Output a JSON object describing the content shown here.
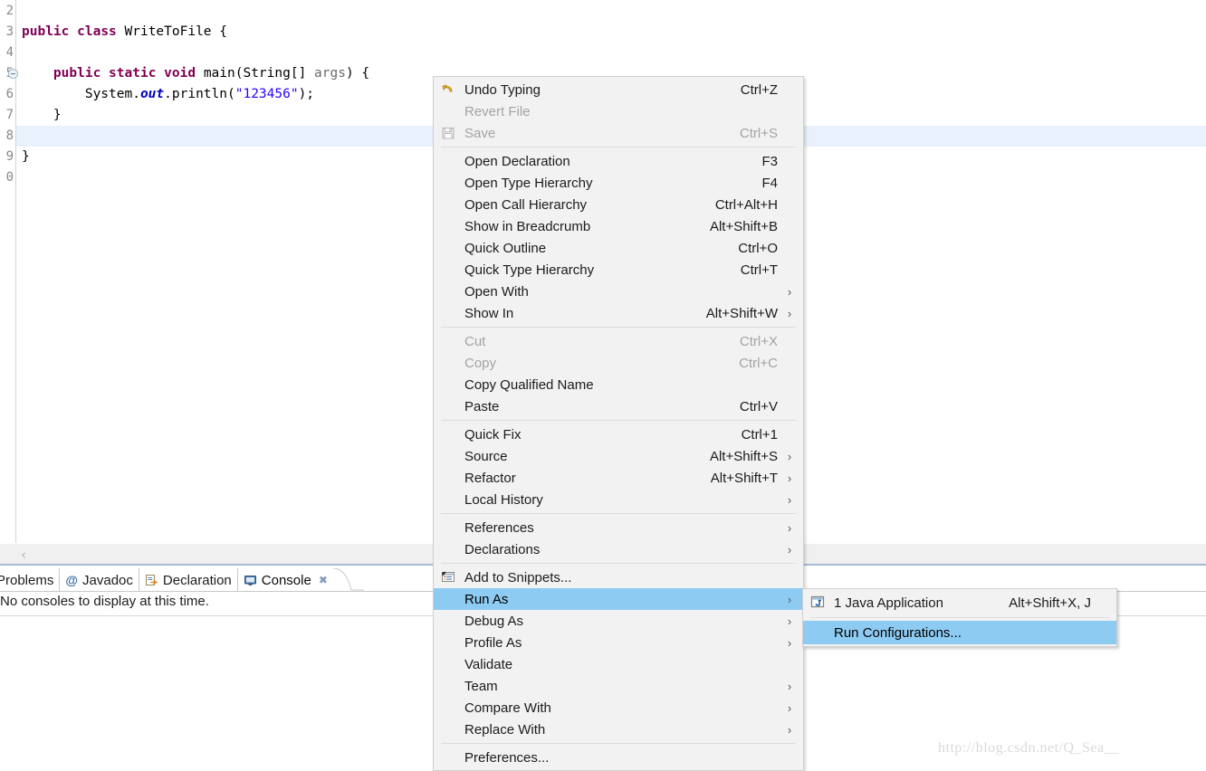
{
  "editor": {
    "gutter_numbers": [
      "2",
      "3",
      "4",
      "5",
      "6",
      "7",
      "8",
      "9",
      "0"
    ],
    "fold_marker_line": "5",
    "current_line": "8",
    "code_lines": [
      {
        "n": "2",
        "tokens": []
      },
      {
        "n": "3",
        "tokens": [
          {
            "t": "public",
            "c": "kw"
          },
          {
            "t": " ",
            "c": "pln"
          },
          {
            "t": "class",
            "c": "kw"
          },
          {
            "t": " WriteToFile {",
            "c": "pln"
          }
        ]
      },
      {
        "n": "4",
        "tokens": []
      },
      {
        "n": "5",
        "tokens": [
          {
            "t": "    ",
            "c": "pln"
          },
          {
            "t": "public",
            "c": "kw"
          },
          {
            "t": " ",
            "c": "pln"
          },
          {
            "t": "static",
            "c": "kw"
          },
          {
            "t": " ",
            "c": "pln"
          },
          {
            "t": "void",
            "c": "kw"
          },
          {
            "t": " main(String[] ",
            "c": "pln"
          },
          {
            "t": "args",
            "c": "gry"
          },
          {
            "t": ") {",
            "c": "pln"
          }
        ]
      },
      {
        "n": "6",
        "tokens": [
          {
            "t": "        System.",
            "c": "pln"
          },
          {
            "t": "out",
            "c": "fld"
          },
          {
            "t": ".println(",
            "c": "pln"
          },
          {
            "t": "\"123456\"",
            "c": "str"
          },
          {
            "t": ");",
            "c": "pln"
          }
        ]
      },
      {
        "n": "7",
        "tokens": [
          {
            "t": "    }",
            "c": "pln"
          }
        ]
      },
      {
        "n": "8",
        "tokens": []
      },
      {
        "n": "9",
        "tokens": [
          {
            "t": "}",
            "c": "pln"
          }
        ]
      },
      {
        "n": "0",
        "tokens": []
      }
    ]
  },
  "breadcrumb": {
    "collapse_chevron": "‹"
  },
  "bottom_panel": {
    "tabs": [
      {
        "label": "Problems",
        "icon": "problems-icon",
        "active": false,
        "closable": false
      },
      {
        "label": "Javadoc",
        "icon": "javadoc-icon",
        "active": false,
        "closable": false
      },
      {
        "label": "Declaration",
        "icon": "declaration-icon",
        "active": false,
        "closable": false
      },
      {
        "label": "Console",
        "icon": "console-icon",
        "active": true,
        "closable": true
      }
    ],
    "close_glyph": "✖",
    "javadoc_glyph": "@",
    "console_message": "No consoles to display at this time."
  },
  "context_menu": {
    "items": [
      {
        "label": "Undo Typing",
        "accel": "Ctrl+Z",
        "icon": "undo-icon",
        "disabled": false,
        "arrow": false,
        "selected": false
      },
      {
        "label": "Revert File",
        "accel": "",
        "icon": "",
        "disabled": true,
        "arrow": false,
        "selected": false
      },
      {
        "label": "Save",
        "accel": "Ctrl+S",
        "icon": "save-icon",
        "disabled": true,
        "arrow": false,
        "selected": false
      },
      {
        "separator": true
      },
      {
        "label": "Open Declaration",
        "accel": "F3",
        "icon": "",
        "disabled": false,
        "arrow": false,
        "selected": false
      },
      {
        "label": "Open Type Hierarchy",
        "accel": "F4",
        "icon": "",
        "disabled": false,
        "arrow": false,
        "selected": false
      },
      {
        "label": "Open Call Hierarchy",
        "accel": "Ctrl+Alt+H",
        "icon": "",
        "disabled": false,
        "arrow": false,
        "selected": false
      },
      {
        "label": "Show in Breadcrumb",
        "accel": "Alt+Shift+B",
        "icon": "",
        "disabled": false,
        "arrow": false,
        "selected": false
      },
      {
        "label": "Quick Outline",
        "accel": "Ctrl+O",
        "icon": "",
        "disabled": false,
        "arrow": false,
        "selected": false
      },
      {
        "label": "Quick Type Hierarchy",
        "accel": "Ctrl+T",
        "icon": "",
        "disabled": false,
        "arrow": false,
        "selected": false
      },
      {
        "label": "Open With",
        "accel": "",
        "icon": "",
        "disabled": false,
        "arrow": true,
        "selected": false
      },
      {
        "label": "Show In",
        "accel": "Alt+Shift+W",
        "icon": "",
        "disabled": false,
        "arrow": true,
        "selected": false
      },
      {
        "separator": true
      },
      {
        "label": "Cut",
        "accel": "Ctrl+X",
        "icon": "",
        "disabled": true,
        "arrow": false,
        "selected": false
      },
      {
        "label": "Copy",
        "accel": "Ctrl+C",
        "icon": "",
        "disabled": true,
        "arrow": false,
        "selected": false
      },
      {
        "label": "Copy Qualified Name",
        "accel": "",
        "icon": "",
        "disabled": false,
        "arrow": false,
        "selected": false
      },
      {
        "label": "Paste",
        "accel": "Ctrl+V",
        "icon": "",
        "disabled": false,
        "arrow": false,
        "selected": false
      },
      {
        "separator": true
      },
      {
        "label": "Quick Fix",
        "accel": "Ctrl+1",
        "icon": "",
        "disabled": false,
        "arrow": false,
        "selected": false
      },
      {
        "label": "Source",
        "accel": "Alt+Shift+S",
        "icon": "",
        "disabled": false,
        "arrow": true,
        "selected": false
      },
      {
        "label": "Refactor",
        "accel": "Alt+Shift+T",
        "icon": "",
        "disabled": false,
        "arrow": true,
        "selected": false
      },
      {
        "label": "Local History",
        "accel": "",
        "icon": "",
        "disabled": false,
        "arrow": true,
        "selected": false
      },
      {
        "separator": true
      },
      {
        "label": "References",
        "accel": "",
        "icon": "",
        "disabled": false,
        "arrow": true,
        "selected": false
      },
      {
        "label": "Declarations",
        "accel": "",
        "icon": "",
        "disabled": false,
        "arrow": true,
        "selected": false
      },
      {
        "separator": true
      },
      {
        "label": "Add to Snippets...",
        "accel": "",
        "icon": "snippets-icon",
        "disabled": false,
        "arrow": false,
        "selected": false
      },
      {
        "label": "Run As",
        "accel": "",
        "icon": "",
        "disabled": false,
        "arrow": true,
        "selected": true
      },
      {
        "label": "Debug As",
        "accel": "",
        "icon": "",
        "disabled": false,
        "arrow": true,
        "selected": false
      },
      {
        "label": "Profile As",
        "accel": "",
        "icon": "",
        "disabled": false,
        "arrow": true,
        "selected": false
      },
      {
        "label": "Validate",
        "accel": "",
        "icon": "",
        "disabled": false,
        "arrow": false,
        "selected": false
      },
      {
        "label": "Team",
        "accel": "",
        "icon": "",
        "disabled": false,
        "arrow": true,
        "selected": false
      },
      {
        "label": "Compare With",
        "accel": "",
        "icon": "",
        "disabled": false,
        "arrow": true,
        "selected": false
      },
      {
        "label": "Replace With",
        "accel": "",
        "icon": "",
        "disabled": false,
        "arrow": true,
        "selected": false
      },
      {
        "separator": true
      },
      {
        "label": "Preferences...",
        "accel": "",
        "icon": "",
        "disabled": false,
        "arrow": false,
        "selected": false
      }
    ],
    "arrow_glyph": "›"
  },
  "run_as_submenu": {
    "items": [
      {
        "label": "1 Java Application",
        "accel": "Alt+Shift+X, J",
        "icon": "java-application-icon",
        "disabled": false,
        "arrow": false,
        "selected": false
      },
      {
        "separator": true
      },
      {
        "label": "Run Configurations...",
        "accel": "",
        "icon": "",
        "disabled": false,
        "arrow": false,
        "selected": true
      }
    ]
  },
  "watermark": {
    "text": "http://blog.csdn.net/Q_Sea__"
  },
  "colors": {
    "menu_bg": "#f2f2f2",
    "menu_border": "#cfcfcf",
    "selection": "#8dcbf2",
    "disabled_text": "#a3a3a3",
    "current_line": "#e8f1fc",
    "keyword": "#7f0055",
    "string": "#2a00ff",
    "field": "#0000c0"
  }
}
